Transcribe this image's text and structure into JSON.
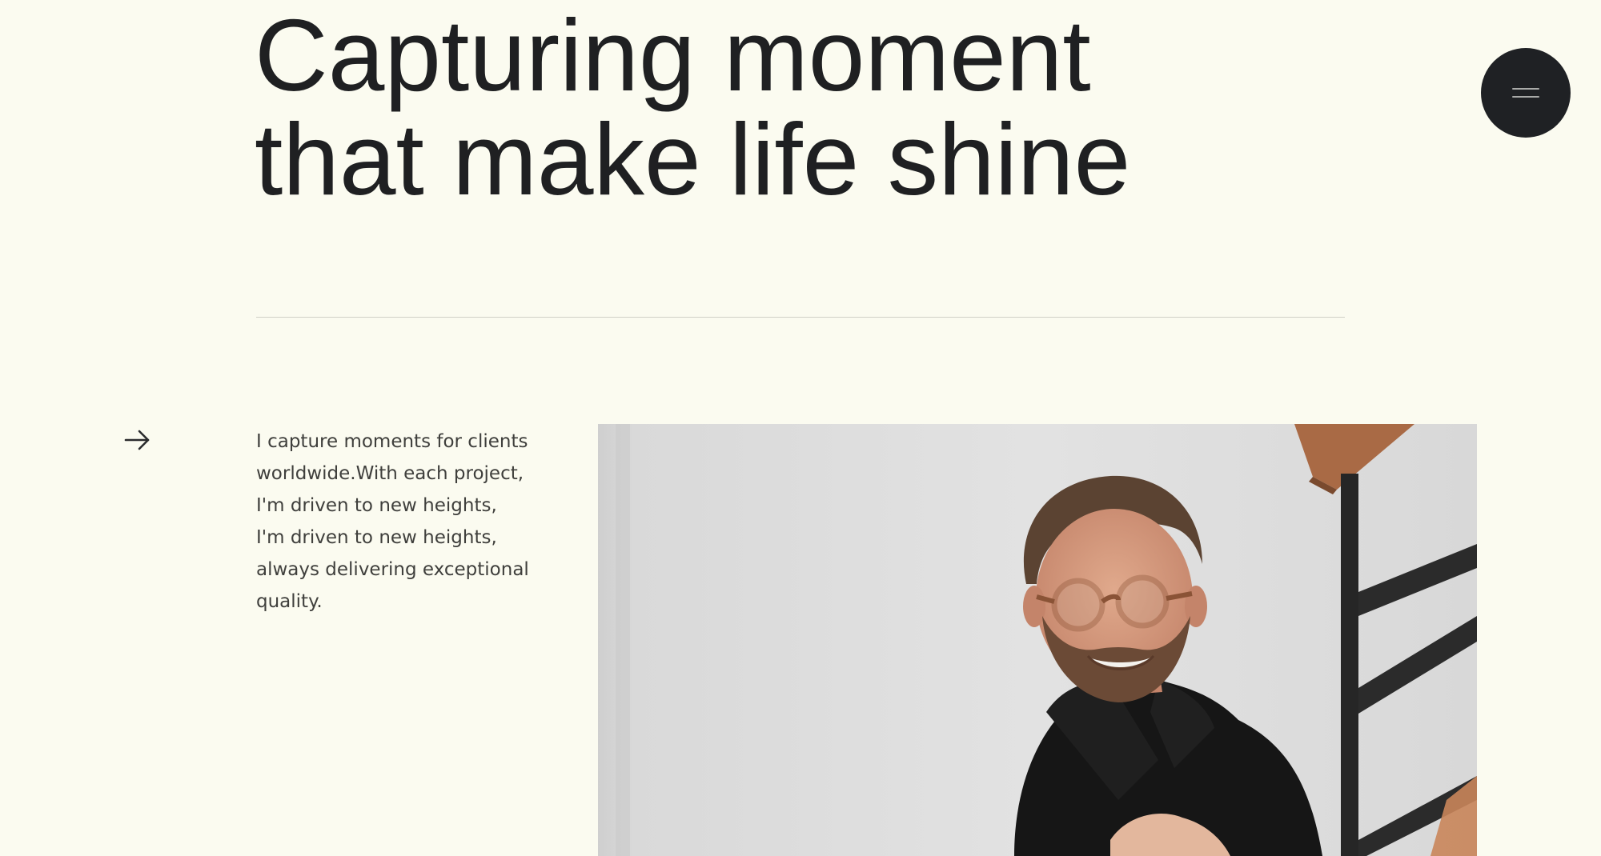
{
  "hero": {
    "title_line_1": "Capturing moment",
    "title_line_2": "that make life shine"
  },
  "menu": {
    "icon": "hamburger-icon",
    "color": "#1f2124"
  },
  "intro": {
    "arrow_icon": "arrow-right-icon",
    "lines": [
      "I capture moments for clients",
      "worldwide.With each project,",
      "I'm driven to new heights,",
      "I'm driven to new heights,",
      "always delivering exceptional",
      "quality."
    ]
  },
  "photo": {
    "subject": "portrait-photo"
  },
  "colors": {
    "background": "#fbfbf0",
    "text": "#1f2022",
    "divider": "#cfd0c6"
  }
}
